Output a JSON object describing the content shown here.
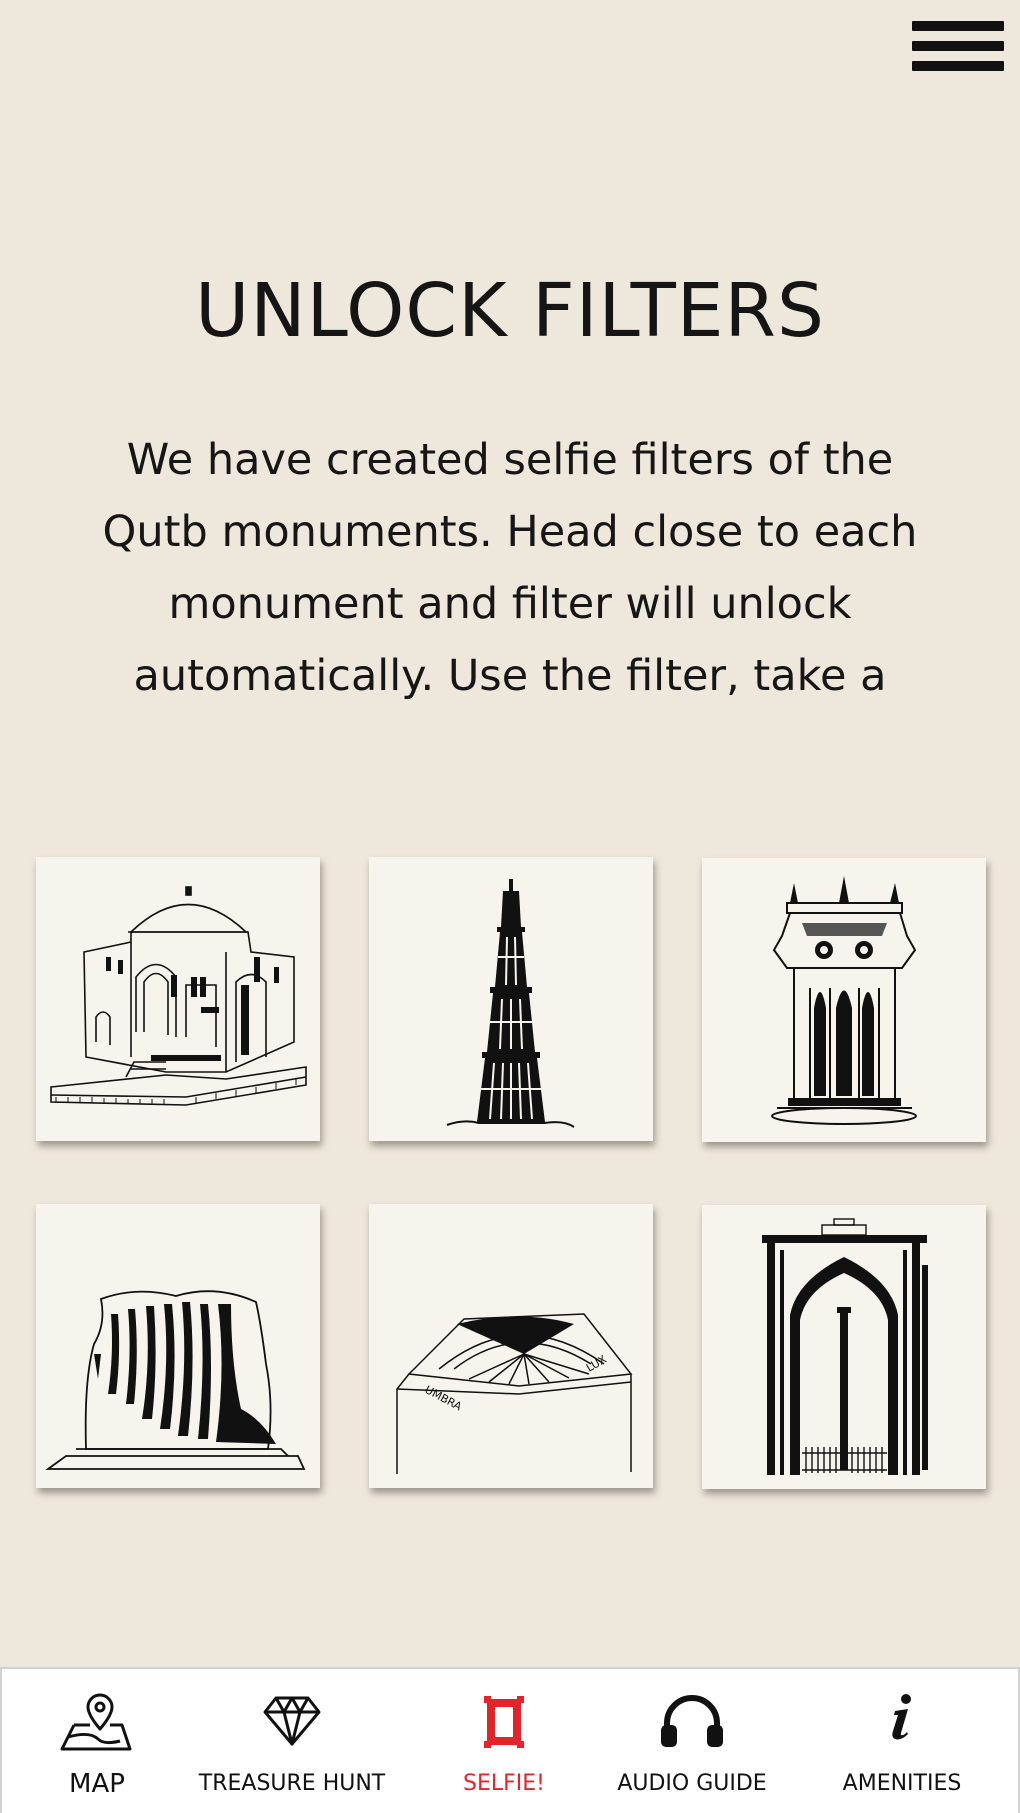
{
  "header": {
    "menu_icon": "hamburger-icon"
  },
  "title": "UNLOCK FILTERS",
  "description": "We have created selfie filters of the Qutb monuments. Head close to each monument and filter will unlock automatically. Use the filter, take a",
  "filters": [
    {
      "icon": "tomb-illustration"
    },
    {
      "icon": "qutb-minar-illustration"
    },
    {
      "icon": "pavilion-illustration"
    },
    {
      "icon": "alai-minar-illustration"
    },
    {
      "icon": "sundial-illustration"
    },
    {
      "icon": "iron-pillar-gate-illustration"
    }
  ],
  "nav": {
    "items": [
      {
        "label": "MAP",
        "icon": "map-pin-icon"
      },
      {
        "label": "TREASURE HUNT",
        "icon": "diamond-icon"
      },
      {
        "label": "SELFIE!",
        "icon": "selfie-frame-icon",
        "active": true
      },
      {
        "label": "AUDIO GUIDE",
        "icon": "headphones-icon"
      },
      {
        "label": "AMENITIES",
        "icon": "info-icon"
      }
    ],
    "active_color": "#e3242b"
  },
  "colors": {
    "background": "#eee7db",
    "tile": "#f7f4ee",
    "accent": "#e3242b"
  }
}
